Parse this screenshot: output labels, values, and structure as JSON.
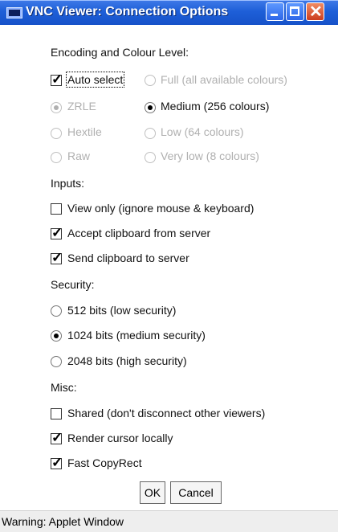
{
  "window": {
    "title": "VNC Viewer: Connection Options",
    "controls": {
      "minimize": "minimize-icon",
      "maximize": "maximize-icon",
      "close": "close-icon"
    }
  },
  "encoding": {
    "label": "Encoding and Colour Level:",
    "auto_select": {
      "label": "Auto select",
      "checked": true
    },
    "encodings": [
      {
        "label": "ZRLE",
        "selected": true,
        "enabled": false
      },
      {
        "label": "Hextile",
        "selected": false,
        "enabled": false
      },
      {
        "label": "Raw",
        "selected": false,
        "enabled": false
      }
    ],
    "colour_levels": [
      {
        "label": "Full (all available colours)",
        "selected": false,
        "enabled": false
      },
      {
        "label": "Medium (256 colours)",
        "selected": true,
        "enabled": true
      },
      {
        "label": "Low (64 colours)",
        "selected": false,
        "enabled": false
      },
      {
        "label": "Very low (8 colours)",
        "selected": false,
        "enabled": false
      }
    ]
  },
  "inputs": {
    "label": "Inputs:",
    "options": [
      {
        "label": "View only (ignore mouse & keyboard)",
        "checked": false
      },
      {
        "label": "Accept clipboard from server",
        "checked": true
      },
      {
        "label": "Send clipboard to server",
        "checked": true
      }
    ]
  },
  "security": {
    "label": "Security:",
    "options": [
      {
        "label": "512 bits (low security)",
        "selected": false
      },
      {
        "label": "1024 bits (medium security)",
        "selected": true
      },
      {
        "label": "2048 bits (high security)",
        "selected": false
      }
    ]
  },
  "misc": {
    "label": "Misc:",
    "options": [
      {
        "label": "Shared (don't disconnect other viewers)",
        "checked": false
      },
      {
        "label": "Render cursor locally",
        "checked": true
      },
      {
        "label": "Fast CopyRect",
        "checked": true
      }
    ]
  },
  "buttons": {
    "ok": "OK",
    "cancel": "Cancel"
  },
  "status": "Warning: Applet Window",
  "colors": {
    "titlebar": "#1e5fd8",
    "close_button": "#cc3d1f",
    "disabled_text": "#b0b0b0"
  }
}
